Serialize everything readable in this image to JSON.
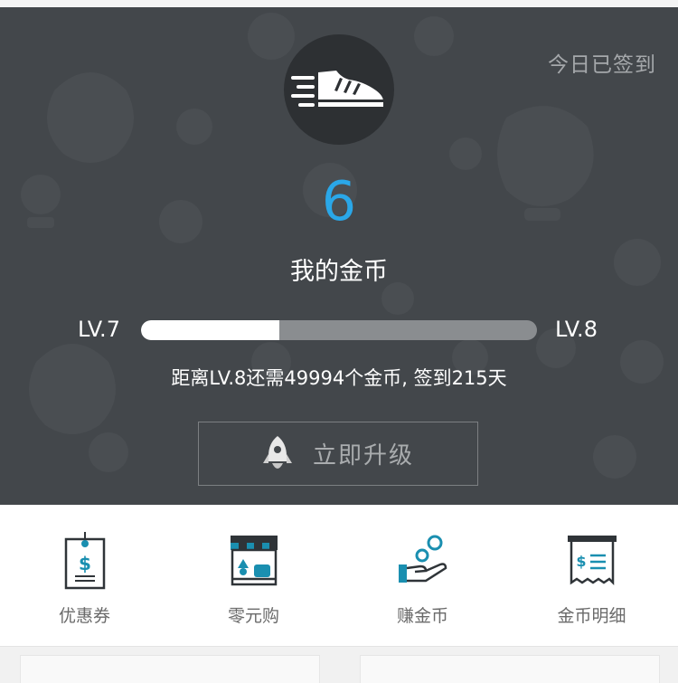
{
  "header": {
    "signed_status": "今日已签到",
    "shoe_icon": "sneaker-icon",
    "coin_count": "6",
    "coin_title": "我的金币",
    "level_current": "LV.7",
    "level_next": "LV.8",
    "level_progress": 0.35,
    "progress_note": "距离LV.8还需49994个金币, 签到215天",
    "upgrade_icon": "rocket-icon",
    "upgrade_label": "立即升级"
  },
  "menu": {
    "items": [
      {
        "label": "优惠券",
        "icon": "coupon-icon"
      },
      {
        "label": "零元购",
        "icon": "storefront-icon"
      },
      {
        "label": "赚金币",
        "icon": "hand-coins-icon"
      },
      {
        "label": "金币明细",
        "icon": "receipt-icon"
      }
    ]
  },
  "colors": {
    "hero_bg": "#43474b",
    "accent_blue": "#2aa7e8",
    "icon_teal": "#1a8fb0",
    "icon_dark": "#2f3438"
  }
}
